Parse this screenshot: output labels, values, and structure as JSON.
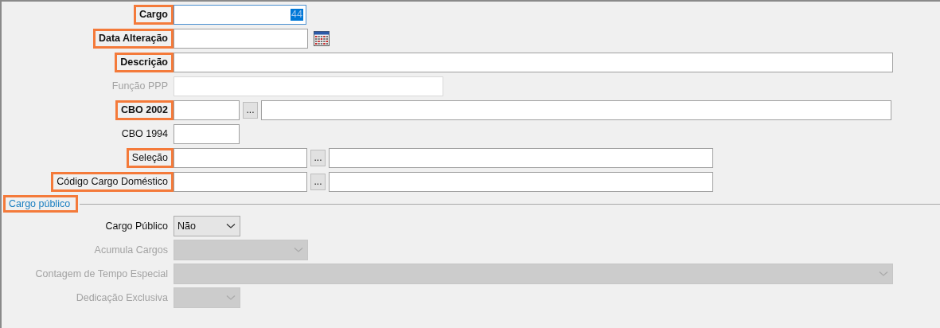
{
  "fields": [
    {
      "kind": "text",
      "label": "Cargo",
      "bold": true,
      "highlighted": true,
      "disabled": false,
      "focused": true,
      "value": "44"
    },
    {
      "kind": "date",
      "label": "Data Alteração",
      "bold": true,
      "highlighted": true,
      "disabled": false,
      "focused": false
    },
    {
      "kind": "text",
      "label": "Descrição",
      "bold": true,
      "highlighted": true,
      "disabled": false,
      "focused": false
    },
    {
      "kind": "text",
      "label": "Função PPP",
      "bold": false,
      "highlighted": false,
      "disabled": true,
      "focused": false
    },
    {
      "kind": "lookup",
      "label": "CBO 2002",
      "bold": true,
      "highlighted": true,
      "disabled": false,
      "focused": false,
      "button": "..."
    },
    {
      "kind": "text",
      "label": "CBO 1994",
      "bold": false,
      "highlighted": false,
      "disabled": false,
      "focused": false
    },
    {
      "kind": "lookup",
      "label": "Seleção",
      "bold": false,
      "highlighted": true,
      "disabled": false,
      "focused": false,
      "button": "..."
    },
    {
      "kind": "lookup",
      "label": "Código Cargo Doméstico",
      "bold": false,
      "highlighted": true,
      "disabled": false,
      "focused": false,
      "button": "..."
    }
  ],
  "section": {
    "title": "Cargo público",
    "highlighted": true
  },
  "public_fields": [
    {
      "label": "Cargo Público",
      "disabled": false,
      "value": "Não"
    },
    {
      "label": "Acumula Cargos",
      "disabled": true
    },
    {
      "label": "Contagem de Tempo Especial",
      "disabled": true
    },
    {
      "label": "Dedicação Exclusiva",
      "disabled": true
    }
  ]
}
